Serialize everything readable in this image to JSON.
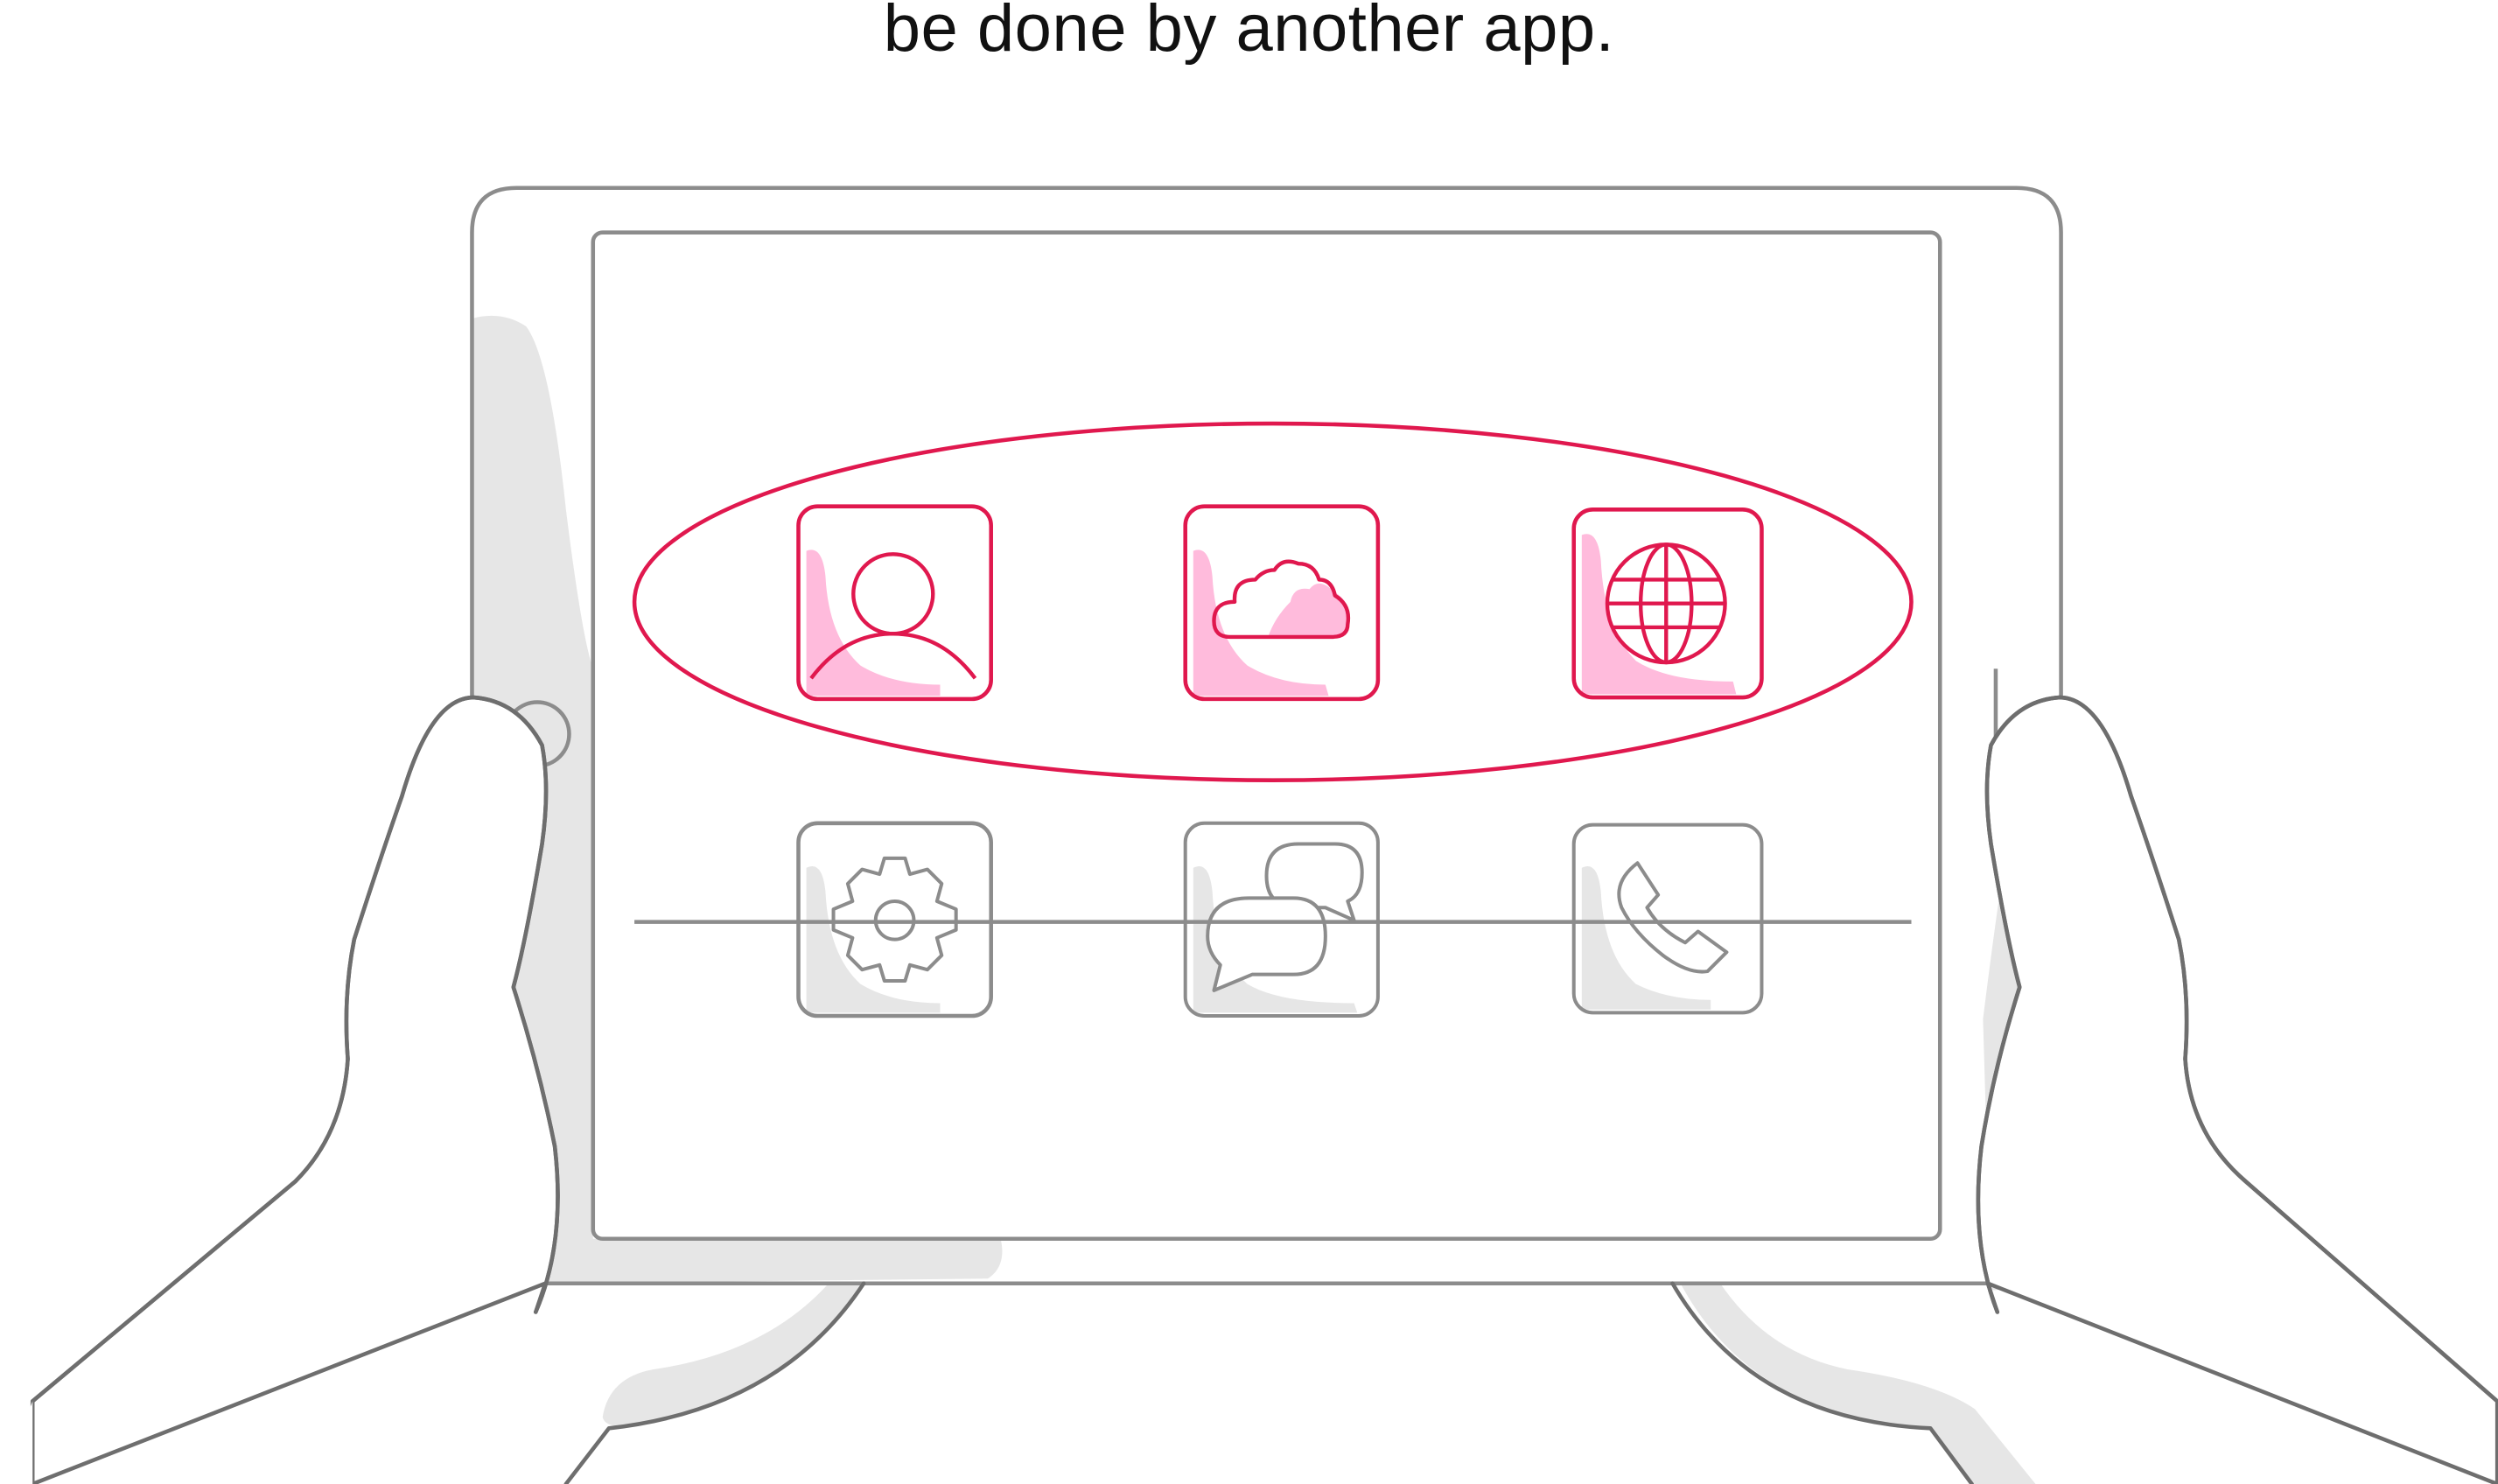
{
  "caption": {
    "text": "be done by another app."
  },
  "colors": {
    "accent": "#e0184e",
    "accent_fill": "#ffbbdc",
    "outline": "#8c8c8c",
    "hand_stroke": "#6e6e6e",
    "shadow": "#e6e6e6",
    "caption": "#111111"
  },
  "highlighted_apps": [
    {
      "icon": "person-icon"
    },
    {
      "icon": "cloud-icon"
    },
    {
      "icon": "globe-icon"
    }
  ],
  "crossed_out_apps": [
    {
      "icon": "gear-icon"
    },
    {
      "icon": "chat-bubbles-icon"
    },
    {
      "icon": "phone-icon"
    }
  ]
}
